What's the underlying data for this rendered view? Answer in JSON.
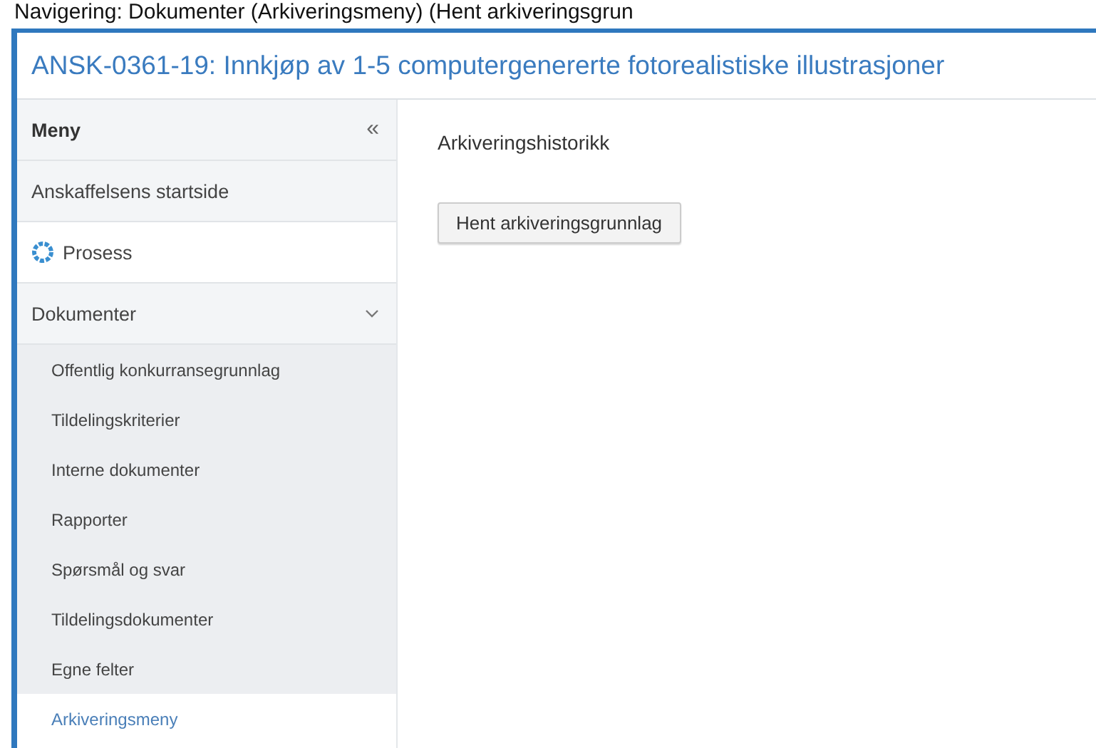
{
  "caption": "Navigering: Dokumenter (Arkiveringsmeny) (Hent arkiveringsgrun",
  "window": {
    "title": "ANSK-0361-19: Innkjøp av 1-5 computergenererte fotorealistiske illustrasjoner"
  },
  "sidebar": {
    "heading": "Meny",
    "collapse_glyph": "«",
    "items": [
      {
        "label": "Anskaffelsens startside",
        "kind": "plain",
        "selected": false
      },
      {
        "label": "Prosess",
        "kind": "icon",
        "selected": false
      },
      {
        "label": "Dokumenter",
        "kind": "group",
        "selected": false,
        "expanded": true,
        "children": [
          {
            "label": "Offentlig konkurransegrunnlag",
            "selected": false
          },
          {
            "label": "Tildelingskriterier",
            "selected": false
          },
          {
            "label": "Interne dokumenter",
            "selected": false
          },
          {
            "label": "Rapporter",
            "selected": false
          },
          {
            "label": "Spørsmål og svar",
            "selected": false
          },
          {
            "label": "Tildelingsdokumenter",
            "selected": false
          },
          {
            "label": "Egne felter",
            "selected": false
          },
          {
            "label": "Arkiveringsmeny",
            "selected": true
          }
        ]
      }
    ]
  },
  "main": {
    "heading": "Arkiveringshistorikk",
    "button": "Hent arkiveringsgrunnlag"
  }
}
